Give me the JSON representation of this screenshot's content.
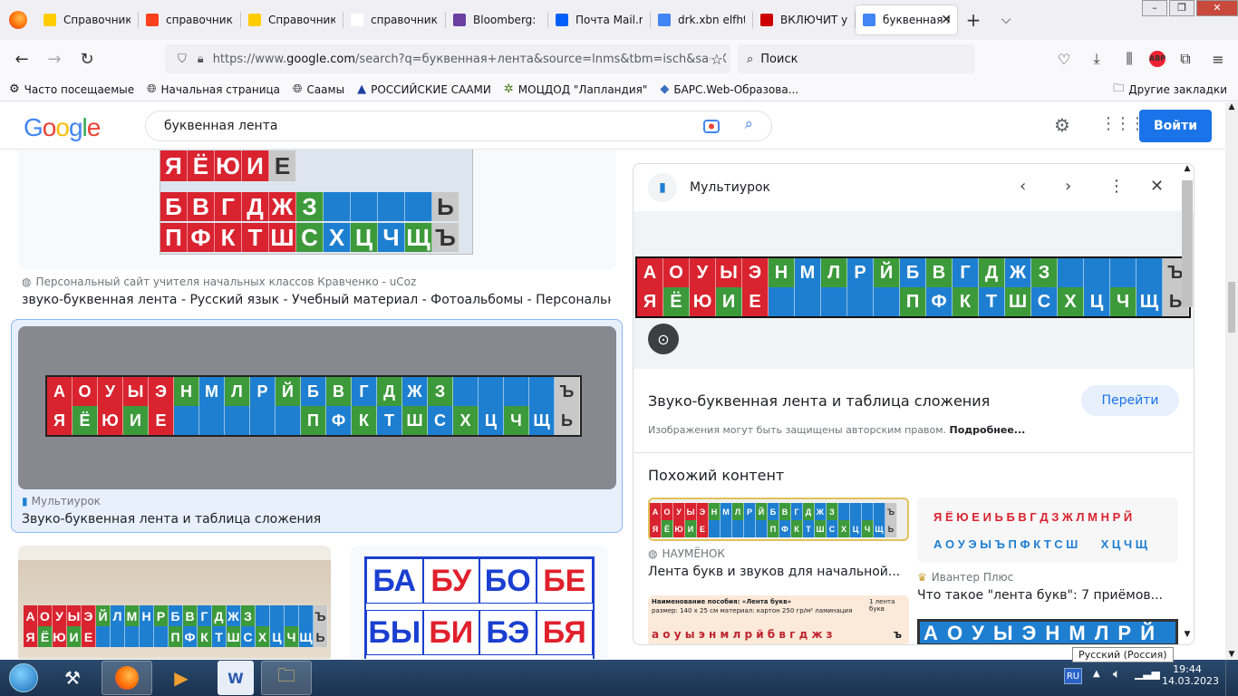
{
  "browser": {
    "tabs": [
      {
        "label": "Справочник д",
        "fav": "#ffcc00"
      },
      {
        "label": "справочник д",
        "fav": "#fc3f1d"
      },
      {
        "label": "Справочник д",
        "fav": "#ffcc00"
      },
      {
        "label": "справочник впр р",
        "fav": "#ffffff"
      },
      {
        "label": "Bloomberg: Ро",
        "fav": "#6b3fa0"
      },
      {
        "label": "Почта Mail.ru",
        "fav": "#005ff9"
      },
      {
        "label": "drk.xbn elfhtty",
        "fav": "#4285f4"
      },
      {
        "label": "ВКЛЮЧИТ уда",
        "fav": "#c00"
      },
      {
        "label": "буквенная л",
        "fav": "#4285f4"
      }
    ],
    "url_prefix": "https://www.",
    "url_host": "google.com",
    "url_rest": "/search?q=буквенная+лента&source=lnms&tbm=isch&sa=X",
    "search_placeholder": "Поиск",
    "bookmarks": [
      "Часто посещаемые",
      "Начальная страница",
      "Саамы",
      "РОССИЙСКИЕ СААМИ",
      "МОЦДОД \"Лапландия\"",
      "БАРС.Web-Образова..."
    ],
    "other_bookmarks": "Другие закладки"
  },
  "google": {
    "query": "буквенная лента",
    "login_label": "Войти"
  },
  "results": {
    "r1_source": "Персональный сайт учителя начальных классов Кравченко - uCoz",
    "r1_title": "звуко-буквенная лента - Русский язык - Учебный материал - Фотоальбомы - Персональный с...",
    "r2_source": "Мультиурок",
    "r2_title": "Звуко-буквенная лента и таблица сложения"
  },
  "strips": {
    "top_row": [
      "А",
      "О",
      "У",
      "Ы",
      "Э",
      "Н",
      "М",
      "Л",
      "Р",
      "Й",
      "Б",
      "В",
      "Г",
      "Д",
      "Ж",
      "З",
      "",
      "",
      "",
      "",
      "Ъ"
    ],
    "bottom_row": [
      "Я",
      "Ё",
      "Ю",
      "И",
      "Е",
      "",
      "",
      "",
      "",
      "",
      "П",
      "Ф",
      "К",
      "Т",
      "Ш",
      "С",
      "Х",
      "Ц",
      "Ч",
      "Щ",
      "Ь"
    ],
    "first_top": [
      "Я",
      "Ё",
      "Ю",
      "И",
      "Е"
    ],
    "first_mid": [
      "Б",
      "В",
      "Г",
      "Д",
      "Ж",
      "З",
      "",
      "",
      "",
      "",
      "Ь"
    ],
    "first_bot": [
      "П",
      "Ф",
      "К",
      "Т",
      "Ш",
      "С",
      "Х",
      "Ц",
      "Ч",
      "Щ",
      "Ъ"
    ],
    "photo_top": [
      "А",
      "О",
      "У",
      "Ы",
      "Э",
      "Й",
      "Л",
      "М",
      "Н",
      "Р",
      "Б",
      "В",
      "Г",
      "Д",
      "Ж",
      "З",
      "",
      "",
      "",
      "",
      "Ъ"
    ],
    "photo_bot": [
      "Я",
      "Ё",
      "Ю",
      "И",
      "Е",
      "",
      "",
      "",
      "",
      "",
      "П",
      "Ф",
      "К",
      "Т",
      "Ш",
      "С",
      "Х",
      "Ц",
      "Ч",
      "Щ",
      "Ь"
    ],
    "syllables": [
      "БА",
      "БУ",
      "БО",
      "БЕ",
      "БЫ",
      "БИ",
      "БЭ",
      "БЯ"
    ]
  },
  "panel": {
    "site": "Мультиурок",
    "title": "Звуко-буквенная лента и таблица сложения",
    "go_label": "Перейти",
    "copyright": "Изображения могут быть защищены авторским правом.",
    "more_link": "Подробнее...",
    "similar_heading": "Похожий контент",
    "sim1_source": "НАУМЁНОК",
    "sim1_title": "Лента букв и звуков для начальной...",
    "sim2_source": "Ивантер Плюс",
    "sim2_title": "Что такое \"лента букв\": 7 приёмов...",
    "sim3_caption": "Наименование пособия: «Лента букв»",
    "sim3_size": "размер: 140 x 25 см   материал: картон 250 гр/м²   ламинация",
    "sim3_badge": "1 лента букв",
    "sim3_letters": "а о у ы э н м л р й б в г д ж з",
    "sim3_end": "ъ",
    "sim2_row1": "Я Ё Ю Е И Ь Б В Г Д З Ж Л М Н Р Й",
    "sim2_row2": "А О У Э Ы Ъ П Ф К Т С Ш       Х Ц Ч Щ",
    "sim4_letters": "А О У Ы Э Н М Л Р Й"
  },
  "taskbar": {
    "lang": "RU",
    "time": "19:44",
    "date": "14.03.2023",
    "tooltip": "Русский (Россия)"
  },
  "colors": {
    "red": "#d9232f",
    "green": "#3d9a3b",
    "blue": "#1e7fd1",
    "gray": "#c8c8c8"
  }
}
